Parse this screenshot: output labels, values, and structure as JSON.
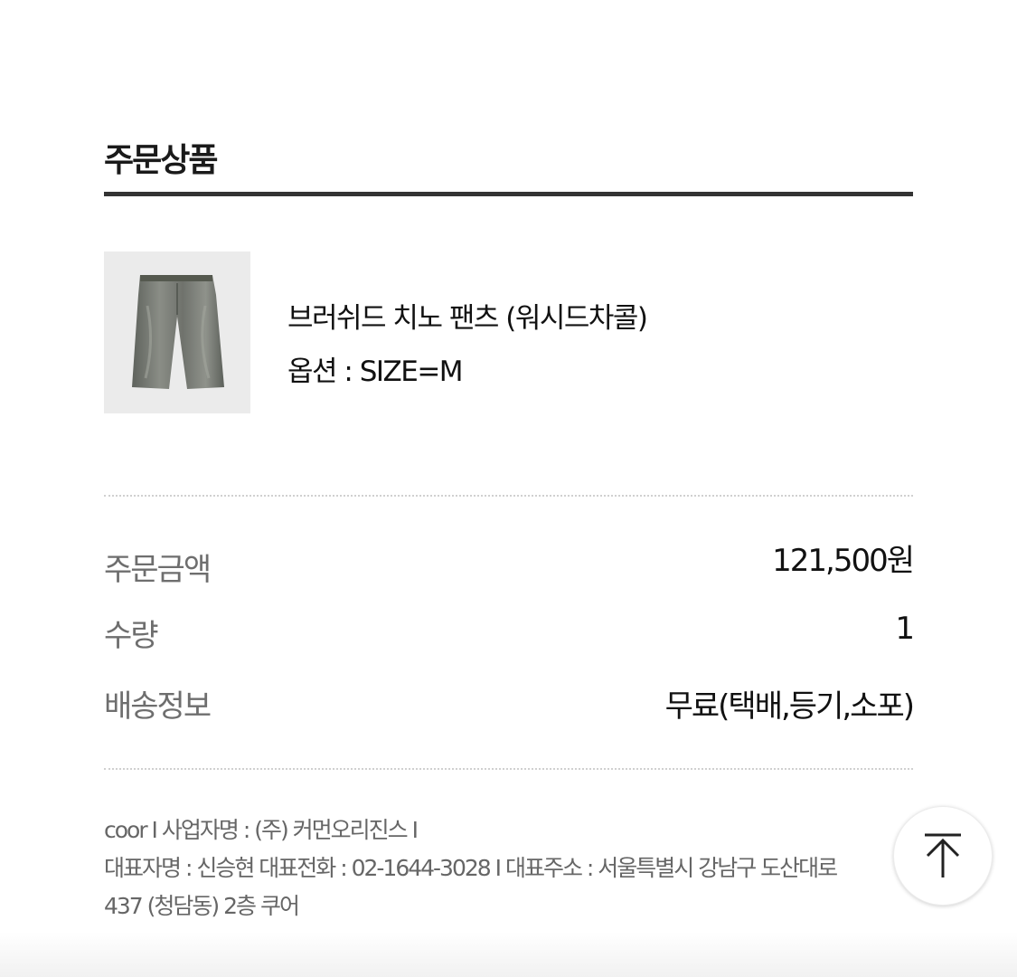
{
  "section": {
    "title": "주문상품"
  },
  "product": {
    "thumbnail_icon": "washed-chino-pants-thumbnail",
    "name": "브러쉬드 치노 팬츠 (워시드차콜)",
    "option": "옵션 : SIZE=M"
  },
  "summary": [
    {
      "label": "주문금액",
      "value": "121,500원"
    },
    {
      "label": "수량",
      "value": "1"
    },
    {
      "label": "배송정보",
      "value": "무료(택배,등기,소포)"
    }
  ],
  "footer": {
    "line1": "coor I 사업자명 : (주) 커먼오리진스 I",
    "line2": "대표자명 : 신승현 대표전화 : 02-1644-3028 I 대표주소 : 서울특별시 강남구 도산대로",
    "line3": "437 (청담동) 2층 쿠어"
  },
  "scroll_top": {
    "icon": "arrow-up-icon"
  },
  "colors": {
    "accent_rule": "#333333",
    "label_gray": "#6e6e6e",
    "text_dark": "#111111"
  }
}
